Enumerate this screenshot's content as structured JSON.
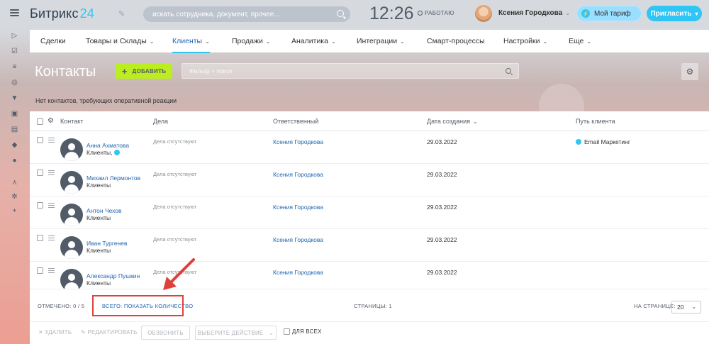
{
  "header": {
    "logo_text": "Битрикс",
    "logo_num": "24",
    "search_placeholder": "искать сотрудника, документ, прочее...",
    "clock": "12:26",
    "work_status": "РАБОТАЮ",
    "user_name": "Ксения Городкова",
    "tariff_label": "Мой тариф",
    "invite_label": "Пригласить"
  },
  "tabs": [
    {
      "label": "Сделки",
      "chevron": false
    },
    {
      "label": "Товары и Склады",
      "chevron": true
    },
    {
      "label": "Клиенты",
      "chevron": true,
      "active": true
    },
    {
      "label": "Продажи",
      "chevron": true
    },
    {
      "label": "Аналитика",
      "chevron": true
    },
    {
      "label": "Интеграции",
      "chevron": true
    },
    {
      "label": "Смарт-процессы",
      "chevron": false
    },
    {
      "label": "Настройки",
      "chevron": true
    },
    {
      "label": "Еще",
      "chevron": true
    }
  ],
  "page": {
    "title": "Контакты",
    "add_button": "ДОБАВИТЬ",
    "filter_placeholder": "Фильтр + поиск",
    "notice": "Нет контактов, требующих оперативной реакции"
  },
  "grid": {
    "columns": {
      "contact": "Контакт",
      "deals": "Дела",
      "responsible": "Ответственный",
      "created": "Дата создания",
      "path": "Путь клиента"
    },
    "rows": [
      {
        "name": "Анна Ахматова",
        "type": "Клиенты,",
        "deals": "Дела отсутствуют",
        "responsible": "Ксения Городкова",
        "date": "29.03.2022",
        "path": "Email Маркетинг"
      },
      {
        "name": "Михаил Лермонтов",
        "type": "Клиенты",
        "deals": "Дела отсутствуют",
        "responsible": "Ксения Городкова",
        "date": "29.03.2022",
        "path": ""
      },
      {
        "name": "Антон Чехов",
        "type": "Клиенты",
        "deals": "Дела отсутствуют",
        "responsible": "Ксения Городкова",
        "date": "29.03.2022",
        "path": ""
      },
      {
        "name": "Иван Тургенев",
        "type": "Клиенты",
        "deals": "Дела отсутствуют",
        "responsible": "Ксения Городкова",
        "date": "29.03.2022",
        "path": ""
      },
      {
        "name": "Александр Пушкин",
        "type": "Клиенты",
        "deals": "Дела отсутствуют",
        "responsible": "Ксения Городкова",
        "date": "29.03.2022",
        "path": ""
      }
    ],
    "footer": {
      "selected": "ОТМЕЧЕНО: 0 / 5",
      "total": "ВСЕГО: ПОКАЗАТЬ КОЛИЧЕСТВО",
      "pages": "СТРАНИЦЫ: 1",
      "per_page_label": "НА СТРАНИЦЕ:",
      "per_page_value": "20"
    }
  },
  "actions": {
    "delete": "УДАЛИТЬ",
    "edit": "РЕДАКТИРОВАТЬ",
    "call": "ОБЗВОНИТЬ",
    "choose": "ВЫБЕРИТЕ ДЕЙСТВИЕ",
    "for_all": "ДЛЯ ВСЕХ"
  },
  "colors": {
    "accent": "#2fc6f6",
    "add_button": "#bbed21",
    "link": "#2067b0",
    "highlight": "#e0403a"
  }
}
